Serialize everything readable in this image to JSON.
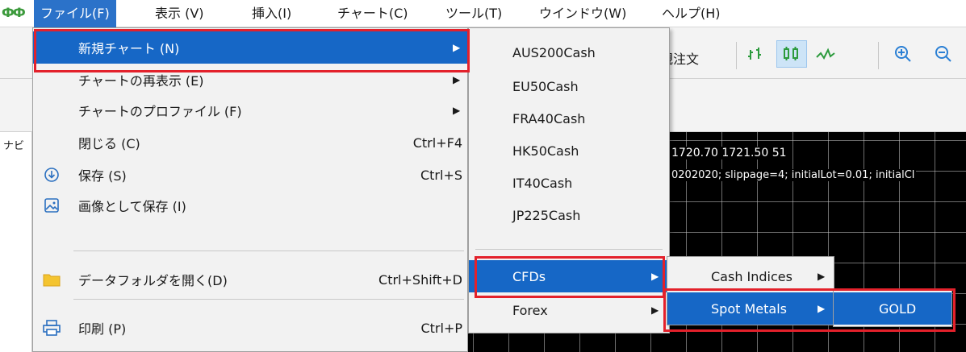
{
  "menubar": {
    "logo": "ФФ",
    "items": [
      {
        "label": "ファイル(F)",
        "active": true
      },
      {
        "label": "表示 (V)"
      },
      {
        "label": "挿入(I)"
      },
      {
        "label": "チャート(C)"
      },
      {
        "label": "ツール(T)"
      },
      {
        "label": "ウインドウ(W)"
      },
      {
        "label": "ヘルプ(H)"
      }
    ]
  },
  "toolbar": {
    "new_order_label": "規注文",
    "icons": [
      "bar-chart-icon",
      "candlestick-icon",
      "line-chart-icon",
      "zoom-in-icon",
      "zoom-out-icon"
    ]
  },
  "chart": {
    "info_line1": "1720.70 1721.50  51",
    "info_line2": "0202020; slippage=4; initialLot=0.01; initialCl"
  },
  "file_menu": {
    "items": [
      {
        "label": "新規チャート (N)",
        "shortcut": "",
        "submenu": true,
        "highlighted": true
      },
      {
        "label": "チャートの再表示 (E)",
        "shortcut": "",
        "submenu": true
      },
      {
        "label": "チャートのプロファイル (F)",
        "shortcut": "",
        "submenu": true
      },
      {
        "label": "閉じる (C)",
        "shortcut": "Ctrl+F4"
      },
      {
        "label": "保存 (S)",
        "shortcut": "Ctrl+S",
        "icon": "save-icon"
      },
      {
        "label": "画像として保存 (I)",
        "shortcut": "",
        "icon": "image-icon"
      },
      {
        "label": "データフォルダを開く(D)",
        "shortcut": "Ctrl+Shift+D",
        "icon": "folder-icon"
      },
      {
        "label": "印刷 (P)",
        "shortcut": "Ctrl+P",
        "icon": "print-icon"
      }
    ]
  },
  "new_chart_menu": {
    "items": [
      {
        "label": "AUS200Cash"
      },
      {
        "label": "EU50Cash"
      },
      {
        "label": "FRA40Cash"
      },
      {
        "label": "HK50Cash"
      },
      {
        "label": "IT40Cash"
      },
      {
        "label": "JP225Cash"
      },
      {
        "label": "CFDs",
        "submenu": true,
        "highlighted": true
      },
      {
        "label": "Forex",
        "submenu": true
      }
    ]
  },
  "cfds_menu": {
    "items": [
      {
        "label": "Cash Indices",
        "submenu": true
      },
      {
        "label": "Spot Metals",
        "submenu": true,
        "highlighted": true
      }
    ]
  },
  "metals_menu": {
    "items": [
      {
        "label": "GOLD",
        "highlighted": true
      }
    ]
  },
  "colors": {
    "highlight": "#1667c6",
    "annotation": "#e3212b"
  }
}
